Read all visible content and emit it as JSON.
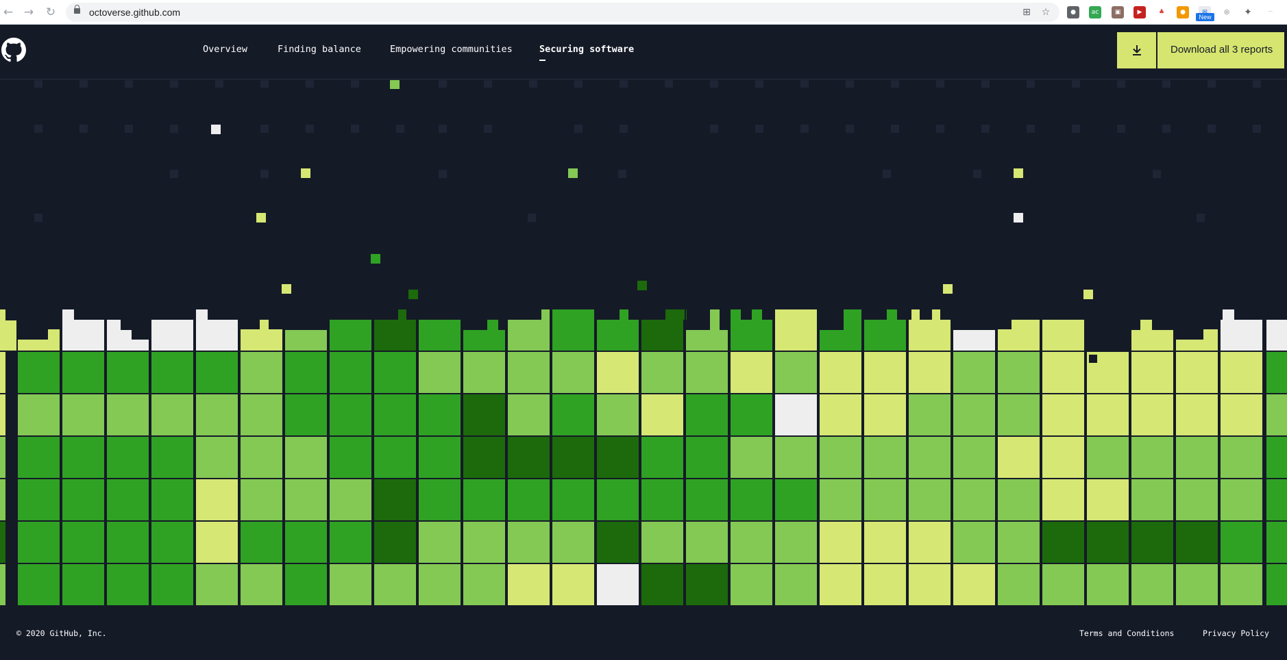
{
  "browser": {
    "url": "octoverse.github.com",
    "back_icon": "arrow-left-icon",
    "forward_icon": "arrow-right-icon",
    "reload_icon": "reload-icon",
    "new_badge": "New"
  },
  "header": {
    "logo": "github-octocat-logo",
    "nav": [
      {
        "label": "Overview",
        "active": false
      },
      {
        "label": "Finding balance",
        "active": false
      },
      {
        "label": "Empowering communities",
        "active": false
      },
      {
        "label": "Securing software",
        "active": true
      }
    ],
    "download_label": "Download all 3 reports",
    "download_icon": "download-icon"
  },
  "graphic": {
    "palette": {
      "0": "#1c6a0c",
      "1": "#2fa224",
      "2": "#84c954",
      "3": "#d6e774",
      "4": "#eeeeef",
      "dim": "#1f2535"
    }
  },
  "footer": {
    "copyright": "© 2020 GitHub, Inc.",
    "terms": "Terms and Conditions",
    "privacy": "Privacy Policy"
  }
}
